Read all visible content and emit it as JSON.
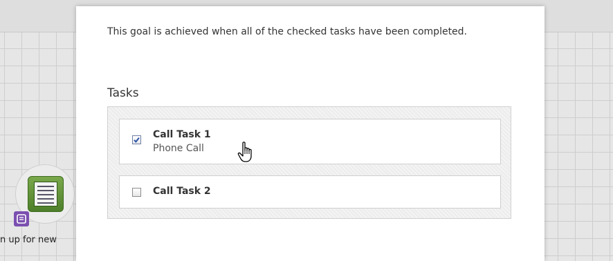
{
  "background": {
    "node_label": "n up for new"
  },
  "dialog": {
    "description": "This goal is achieved when all of the checked tasks have been completed.",
    "tasks_heading": "Tasks",
    "tasks": [
      {
        "name": "Call Task 1",
        "type": "Phone Call",
        "checked": true
      },
      {
        "name": "Call Task 2",
        "checked": false
      }
    ]
  },
  "icons": {
    "node": "document-list-icon",
    "badge": "note-icon",
    "cursor": "hand-pointer-cursor-icon",
    "checkmark": "checkmark-icon"
  },
  "colors": {
    "node_green": "#5e8f36",
    "badge_purple": "#7b4fb0",
    "check_blue": "#2b55a8"
  }
}
